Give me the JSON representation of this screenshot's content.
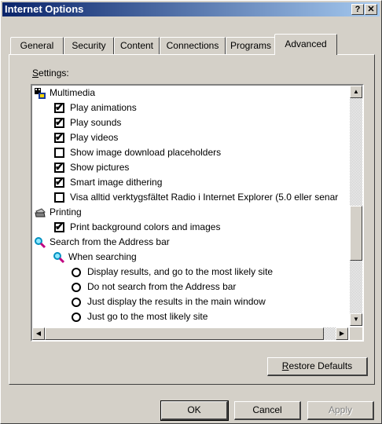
{
  "window": {
    "title": "Internet Options",
    "help_label": "?",
    "close_label": "✕"
  },
  "tabs": [
    {
      "label": "General",
      "active": false
    },
    {
      "label": "Security",
      "active": false
    },
    {
      "label": "Content",
      "active": false
    },
    {
      "label": "Connections",
      "active": false
    },
    {
      "label": "Programs",
      "active": false
    },
    {
      "label": "Advanced",
      "active": true
    }
  ],
  "settings": {
    "label": "Settings:",
    "items": [
      {
        "kind": "group",
        "icon": "multimedia-icon",
        "label": "Multimedia"
      },
      {
        "kind": "checkbox",
        "checked": true,
        "label": "Play animations"
      },
      {
        "kind": "checkbox",
        "checked": true,
        "label": "Play sounds"
      },
      {
        "kind": "checkbox",
        "checked": true,
        "label": "Play videos"
      },
      {
        "kind": "checkbox",
        "checked": false,
        "label": "Show image download placeholders"
      },
      {
        "kind": "checkbox",
        "checked": true,
        "label": "Show pictures"
      },
      {
        "kind": "checkbox",
        "checked": true,
        "label": "Smart image dithering"
      },
      {
        "kind": "checkbox",
        "checked": false,
        "label": "Visa alltid verktygsfältet Radio i Internet Explorer (5.0 eller senar"
      },
      {
        "kind": "group",
        "icon": "printer-icon",
        "label": "Printing"
      },
      {
        "kind": "checkbox",
        "checked": true,
        "label": "Print background colors and images"
      },
      {
        "kind": "group",
        "icon": "magnifier-icon",
        "label": "Search from the Address bar"
      },
      {
        "kind": "subgroup",
        "icon": "magnifier-icon",
        "label": "When searching"
      },
      {
        "kind": "radio",
        "checked": false,
        "label": "Display results, and go to the most likely site"
      },
      {
        "kind": "radio",
        "checked": false,
        "label": "Do not search from the Address bar"
      },
      {
        "kind": "radio",
        "checked": false,
        "label": "Just display the results in the main window"
      },
      {
        "kind": "radio",
        "checked": false,
        "label": "Just go to the most likely site"
      }
    ]
  },
  "scrollbar": {
    "up_icon": "▲",
    "down_icon": "▼",
    "left_icon": "◀",
    "right_icon": "▶"
  },
  "buttons": {
    "restore_defaults": "Restore Defaults",
    "ok": "OK",
    "cancel": "Cancel",
    "apply": "Apply"
  },
  "colors": {
    "titlebar_start": "#0a246a",
    "titlebar_end": "#a6caf0",
    "face": "#d4d0c8",
    "disabled_text": "#808080"
  }
}
